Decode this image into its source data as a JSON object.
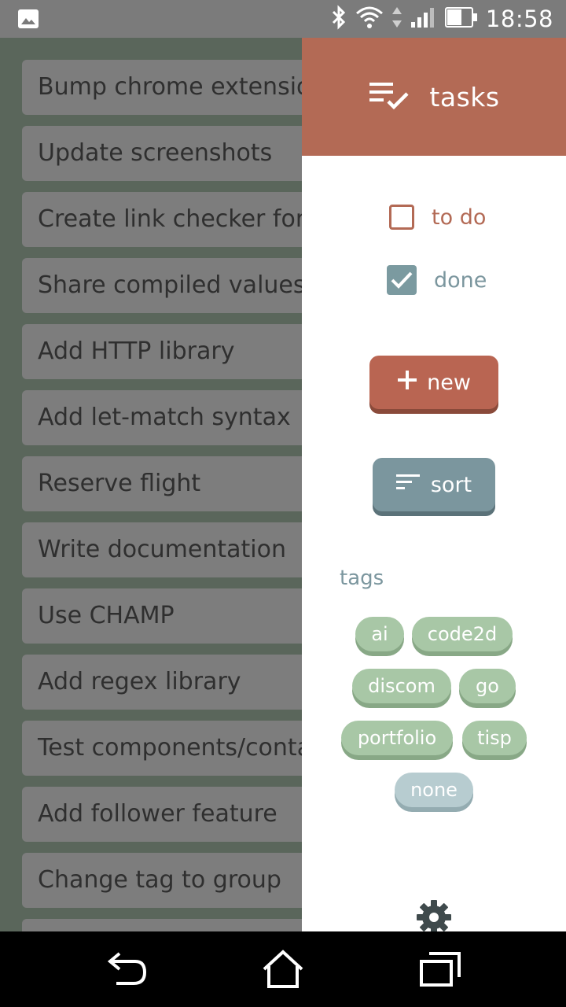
{
  "status_bar": {
    "time": "18:58",
    "icons": [
      "image-icon",
      "bluetooth-icon",
      "wifi-icon",
      "signal-icon",
      "battery-icon"
    ]
  },
  "tasks": [
    "Bump chrome extension",
    "Update screenshots",
    "Create link checker for r",
    "Share compiled values i",
    "Add HTTP library",
    "Add let-match syntax",
    "Reserve flight",
    "Write documentation",
    "Use CHAMP",
    "Add regex library",
    "Test components/conta",
    "Add follower feature",
    "Change tag to group"
  ],
  "drawer": {
    "title": "tasks",
    "filters": [
      {
        "label": "to do",
        "checked": false
      },
      {
        "label": "done",
        "checked": true
      }
    ],
    "new_label": "new",
    "sort_label": "sort",
    "tags_label": "tags",
    "tags": [
      "ai",
      "code2d",
      "discom",
      "go",
      "portfolio",
      "tisp",
      "none"
    ]
  },
  "colors": {
    "accent": "#b36a55",
    "secondary": "#7b969e",
    "tag": "#a8c7a6",
    "overlay_bg": "#5a665b"
  }
}
